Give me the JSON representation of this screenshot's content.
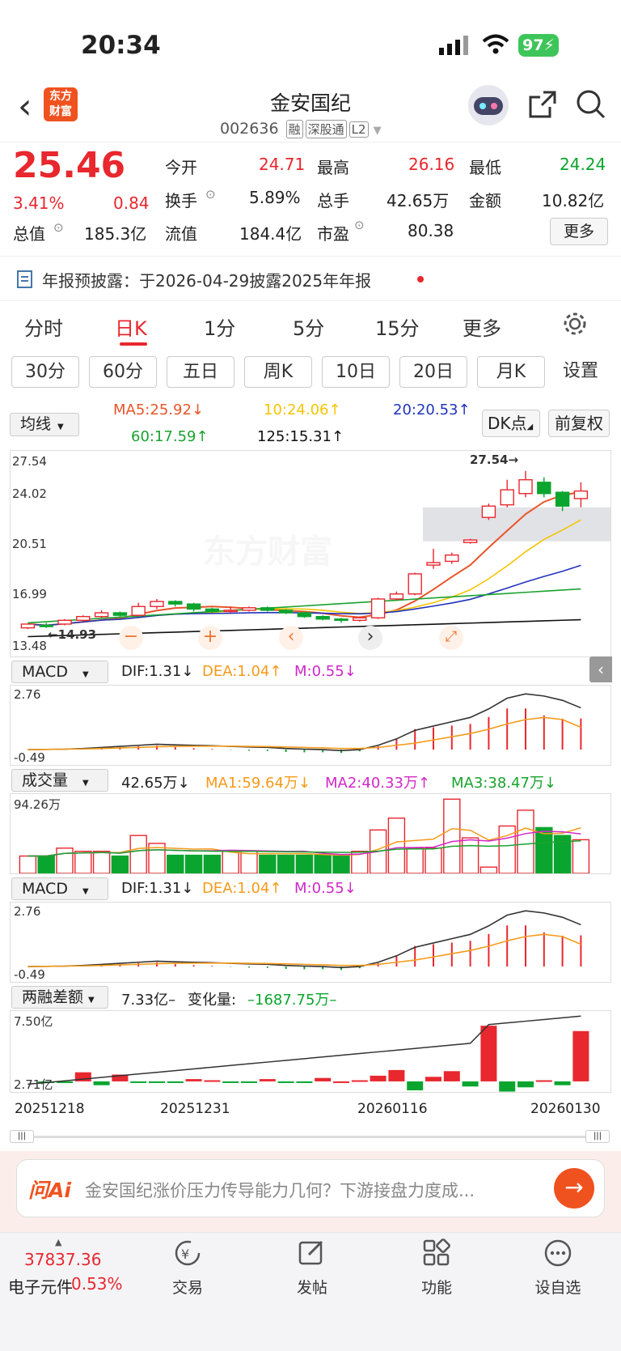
{
  "status": {
    "time": "20:34",
    "battery": "97"
  },
  "header": {
    "back": "‹",
    "logo_line1": "东方",
    "logo_line2": "财富",
    "title": "金安国纪",
    "code": "002636",
    "tags": [
      "融",
      "深股通",
      "L2"
    ]
  },
  "quote": {
    "price": "25.46",
    "pct": "3.41%",
    "chg": "0.84",
    "fields": [
      {
        "k": "今开",
        "v": "24.71",
        "c": "red"
      },
      {
        "k": "最高",
        "v": "26.16",
        "c": "red"
      },
      {
        "k": "最低",
        "v": "24.24",
        "c": "green"
      },
      {
        "k": "换手",
        "v": "5.89%",
        "c": ""
      },
      {
        "k": "总手",
        "v": "42.65万",
        "c": ""
      },
      {
        "k": "金额",
        "v": "10.82亿",
        "c": ""
      },
      {
        "k": "总值",
        "v": "185.3亿",
        "c": ""
      },
      {
        "k": "流值",
        "v": "184.4亿",
        "c": ""
      },
      {
        "k": "市盈",
        "v": "80.38",
        "c": ""
      }
    ],
    "more": "更多"
  },
  "notice": {
    "text": "年报预披露：于2026-04-29披露2025年年报"
  },
  "tabs": [
    "分时",
    "日K",
    "1分",
    "5分",
    "15分",
    "更多"
  ],
  "periods": [
    "30分",
    "60分",
    "五日",
    "周K",
    "10日",
    "20日",
    "月K",
    "设置"
  ],
  "ma": {
    "selector": "均线",
    "ma5": "MA5:25.92↓",
    "ma10": "10:24.06↑",
    "ma20": "20:20.53↑",
    "ma60": "60:17.59↑",
    "ma125": "125:15.31↑",
    "dk": "DK点",
    "fq": "前复权"
  },
  "kaxis": {
    "y1": "27.54",
    "y2": "24.02",
    "y3": "20.51",
    "y4": "16.99",
    "y5": "13.48",
    "high": "27.54",
    "low": "14.93",
    "watermark": "东方财富"
  },
  "macd": {
    "name": "MACD",
    "dif": "DIF:1.31↓",
    "dea": "DEA:1.04↑",
    "m": "M:0.55↓",
    "top": "2.76",
    "bot": "-0.49"
  },
  "vol": {
    "name": "成交量",
    "v": "42.65万↓",
    "ma1": "MA1:59.64万↓",
    "ma2": "MA2:40.33万↑",
    "ma3": "MA3:38.47万↓",
    "top": "94.26万"
  },
  "margin": {
    "name": "两融差额",
    "v": "7.33亿–",
    "chg_label": "变化量:",
    "chg": "–1687.75万–",
    "top": "7.50亿",
    "bot": "2.71亿"
  },
  "dates": [
    "20251218",
    "20251231",
    "20260116",
    "20260130"
  ],
  "ai": {
    "brand": "问Ai",
    "text": "金安国纪涨价压力传导能力几何？下游接盘力度成..."
  },
  "bottom": {
    "index_val": "37837.36",
    "index_name": "电子元件",
    "index_pct": "0.53%",
    "items": [
      "交易",
      "发帖",
      "功能",
      "设自选"
    ]
  },
  "chart_data": {
    "type": "candlestick",
    "ylim": [
      13.48,
      27.54
    ],
    "candles": [
      [
        14.6,
        14.9,
        14.5,
        14.8
      ],
      [
        14.8,
        14.7,
        14.6,
        15.0
      ],
      [
        14.9,
        15.2,
        14.8,
        15.3
      ],
      [
        15.2,
        15.5,
        15.1,
        15.6
      ],
      [
        15.5,
        15.8,
        15.4,
        16.0
      ],
      [
        15.8,
        15.6,
        15.5,
        15.9
      ],
      [
        15.6,
        16.3,
        15.5,
        16.6
      ],
      [
        16.3,
        16.7,
        16.1,
        16.9
      ],
      [
        16.7,
        16.5,
        16.3,
        16.8
      ],
      [
        16.5,
        16.1,
        15.9,
        16.6
      ],
      [
        16.1,
        15.9,
        15.8,
        16.2
      ],
      [
        15.9,
        16.0,
        15.8,
        16.3
      ],
      [
        16.0,
        16.2,
        15.9,
        16.3
      ],
      [
        16.2,
        16.0,
        15.9,
        16.3
      ],
      [
        16.0,
        15.8,
        15.7,
        16.1
      ],
      [
        15.8,
        15.5,
        15.4,
        15.9
      ],
      [
        15.5,
        15.3,
        15.2,
        15.6
      ],
      [
        15.3,
        15.2,
        15.0,
        15.4
      ],
      [
        15.2,
        15.4,
        15.1,
        15.5
      ],
      [
        15.4,
        16.9,
        15.3,
        17.0
      ],
      [
        16.9,
        17.3,
        16.8,
        17.5
      ],
      [
        17.3,
        18.9,
        17.2,
        19.0
      ],
      [
        19.6,
        19.8,
        19.3,
        20.9
      ],
      [
        19.9,
        20.4,
        19.7,
        20.6
      ],
      [
        21.4,
        21.6,
        21.3,
        21.7
      ],
      [
        23.4,
        24.3,
        23.2,
        24.5
      ],
      [
        24.4,
        25.6,
        24.2,
        26.4
      ],
      [
        25.3,
        26.4,
        25.0,
        27.1
      ],
      [
        26.2,
        25.3,
        25.0,
        26.6
      ],
      [
        25.4,
        24.3,
        23.9,
        25.5
      ],
      [
        24.9,
        25.5,
        24.2,
        26.2
      ]
    ],
    "macd_dif": [
      0.0,
      0.01,
      0.02,
      0.05,
      0.1,
      0.15,
      0.2,
      0.25,
      0.22,
      0.2,
      0.18,
      0.15,
      0.12,
      0.1,
      0.05,
      0.02,
      0.0,
      -0.05,
      0.0,
      0.2,
      0.5,
      0.9,
      1.1,
      1.3,
      1.5,
      1.9,
      2.4,
      2.6,
      2.5,
      2.3,
      1.95
    ],
    "macd_dea": [
      0.0,
      0.01,
      0.02,
      0.03,
      0.05,
      0.08,
      0.1,
      0.13,
      0.15,
      0.16,
      0.16,
      0.16,
      0.15,
      0.14,
      0.12,
      0.1,
      0.08,
      0.05,
      0.05,
      0.1,
      0.2,
      0.3,
      0.45,
      0.6,
      0.75,
      0.95,
      1.2,
      1.4,
      1.5,
      1.4,
      1.04
    ],
    "volume": [
      22,
      22,
      32,
      28,
      28,
      22,
      48,
      38,
      23,
      23,
      23,
      28,
      28,
      23,
      23,
      23,
      23,
      23,
      28,
      55,
      70,
      32,
      32,
      94,
      45,
      8,
      60,
      80,
      58,
      48,
      42.65
    ],
    "margin": [
      3.1,
      3.0,
      2.7,
      3.5,
      2.6,
      3.2,
      3.0,
      2.9,
      2.8,
      3.0,
      3.1,
      2.9,
      2.8,
      3.0,
      2.9,
      2.7,
      3.0,
      3.0,
      3.1,
      3.6,
      4.6,
      2.5,
      2.9,
      3.8,
      2.6,
      7.5,
      5.1,
      3.7,
      3.8,
      2.9,
      7.33
    ]
  }
}
